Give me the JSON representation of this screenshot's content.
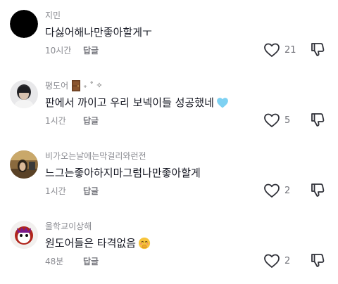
{
  "comments": [
    {
      "username": "지민",
      "text": "다싫어해나만좋아할게ㅜ",
      "time": "10시간",
      "reply_label": "답글",
      "like_count": "21",
      "avatar_color": "#000000"
    },
    {
      "username": "평도어",
      "username_decoration": "🚪 ₊ ˚ ✧",
      "text": "판에서 까이고 우리 보넥이들 성공했네",
      "text_emoji": "light-blue-heart-icon",
      "time": "1시간",
      "reply_label": "답글",
      "like_count": "5"
    },
    {
      "username": "비가오는날에는막걸리와런전",
      "text": "느그는좋아하지마그럼나만좋아할게",
      "time": "1시간",
      "reply_label": "답글",
      "like_count": "2"
    },
    {
      "username": "울학교이상해",
      "text": "원도어들은 타격없음",
      "text_emoji": "hand-over-mouth-emoji-icon",
      "time": "48분",
      "reply_label": "답글",
      "like_count": "2"
    }
  ],
  "colors": {
    "meta_text": "#8a8b91",
    "body_text": "#161823",
    "icon_stroke": "#2f3038",
    "heart_emoji": "#7ed1f2"
  }
}
